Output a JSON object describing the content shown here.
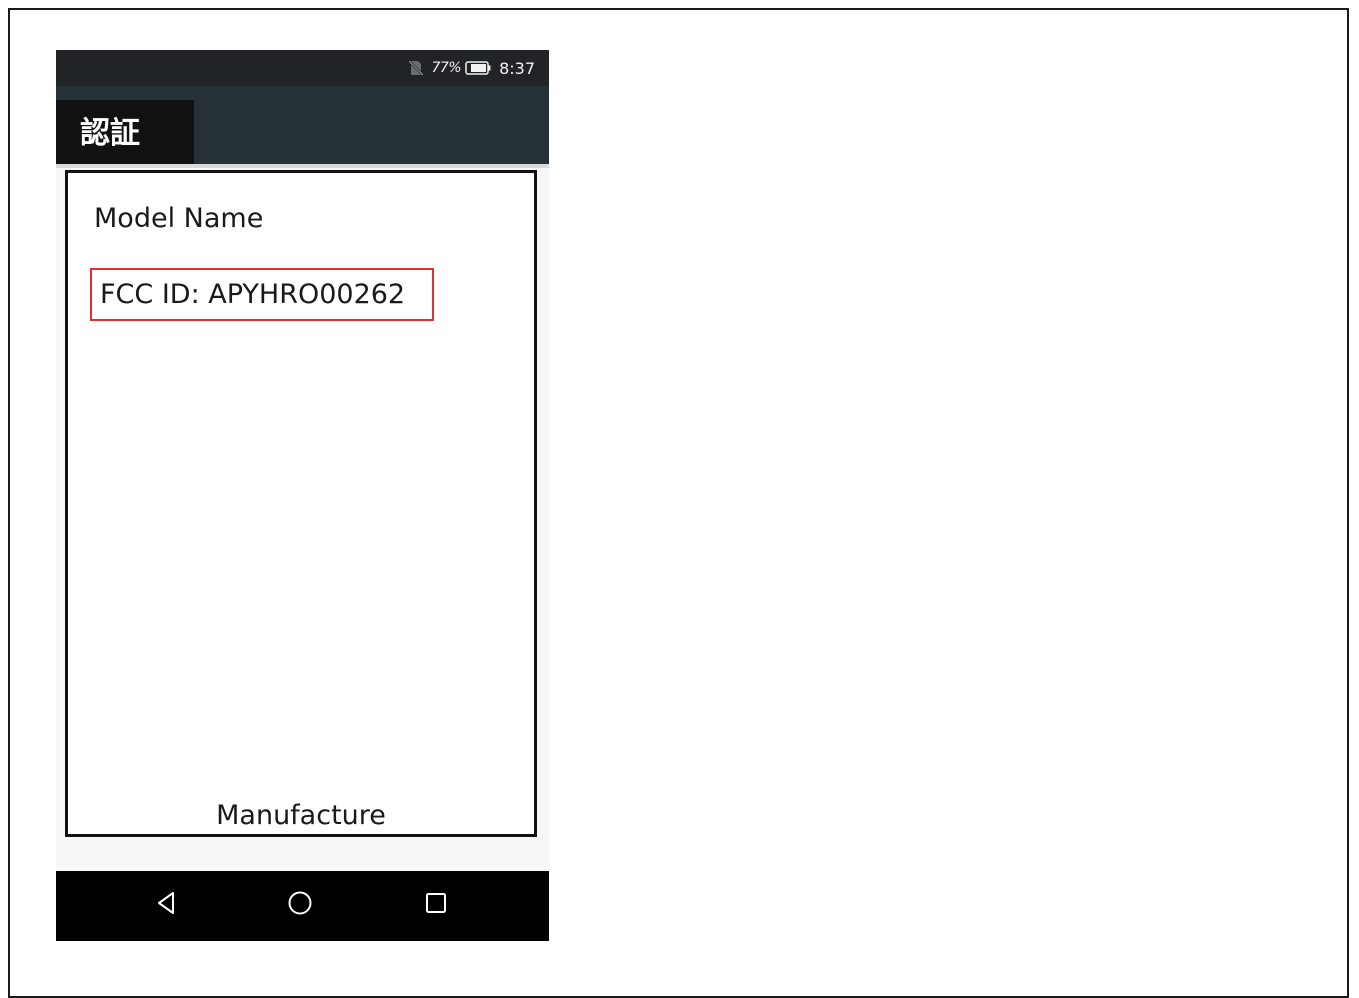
{
  "status_bar": {
    "battery_percent": "77%",
    "time": "8:37",
    "icons": [
      "no-sim-icon",
      "battery-icon"
    ]
  },
  "app_bar": {
    "title": "認証"
  },
  "content": {
    "model_name": "Model Name",
    "fcc_id": "FCC ID: APYHRO00262",
    "manufacture": "Manufacture"
  },
  "nav_bar": {
    "icons": [
      "back-icon",
      "home-icon",
      "recents-icon"
    ]
  },
  "colors": {
    "status_bar_bg": "#202427",
    "app_bar_bg": "#263238",
    "title_tab_bg": "#111111",
    "highlight_border": "#e03030",
    "nav_bar_bg": "#000000"
  }
}
